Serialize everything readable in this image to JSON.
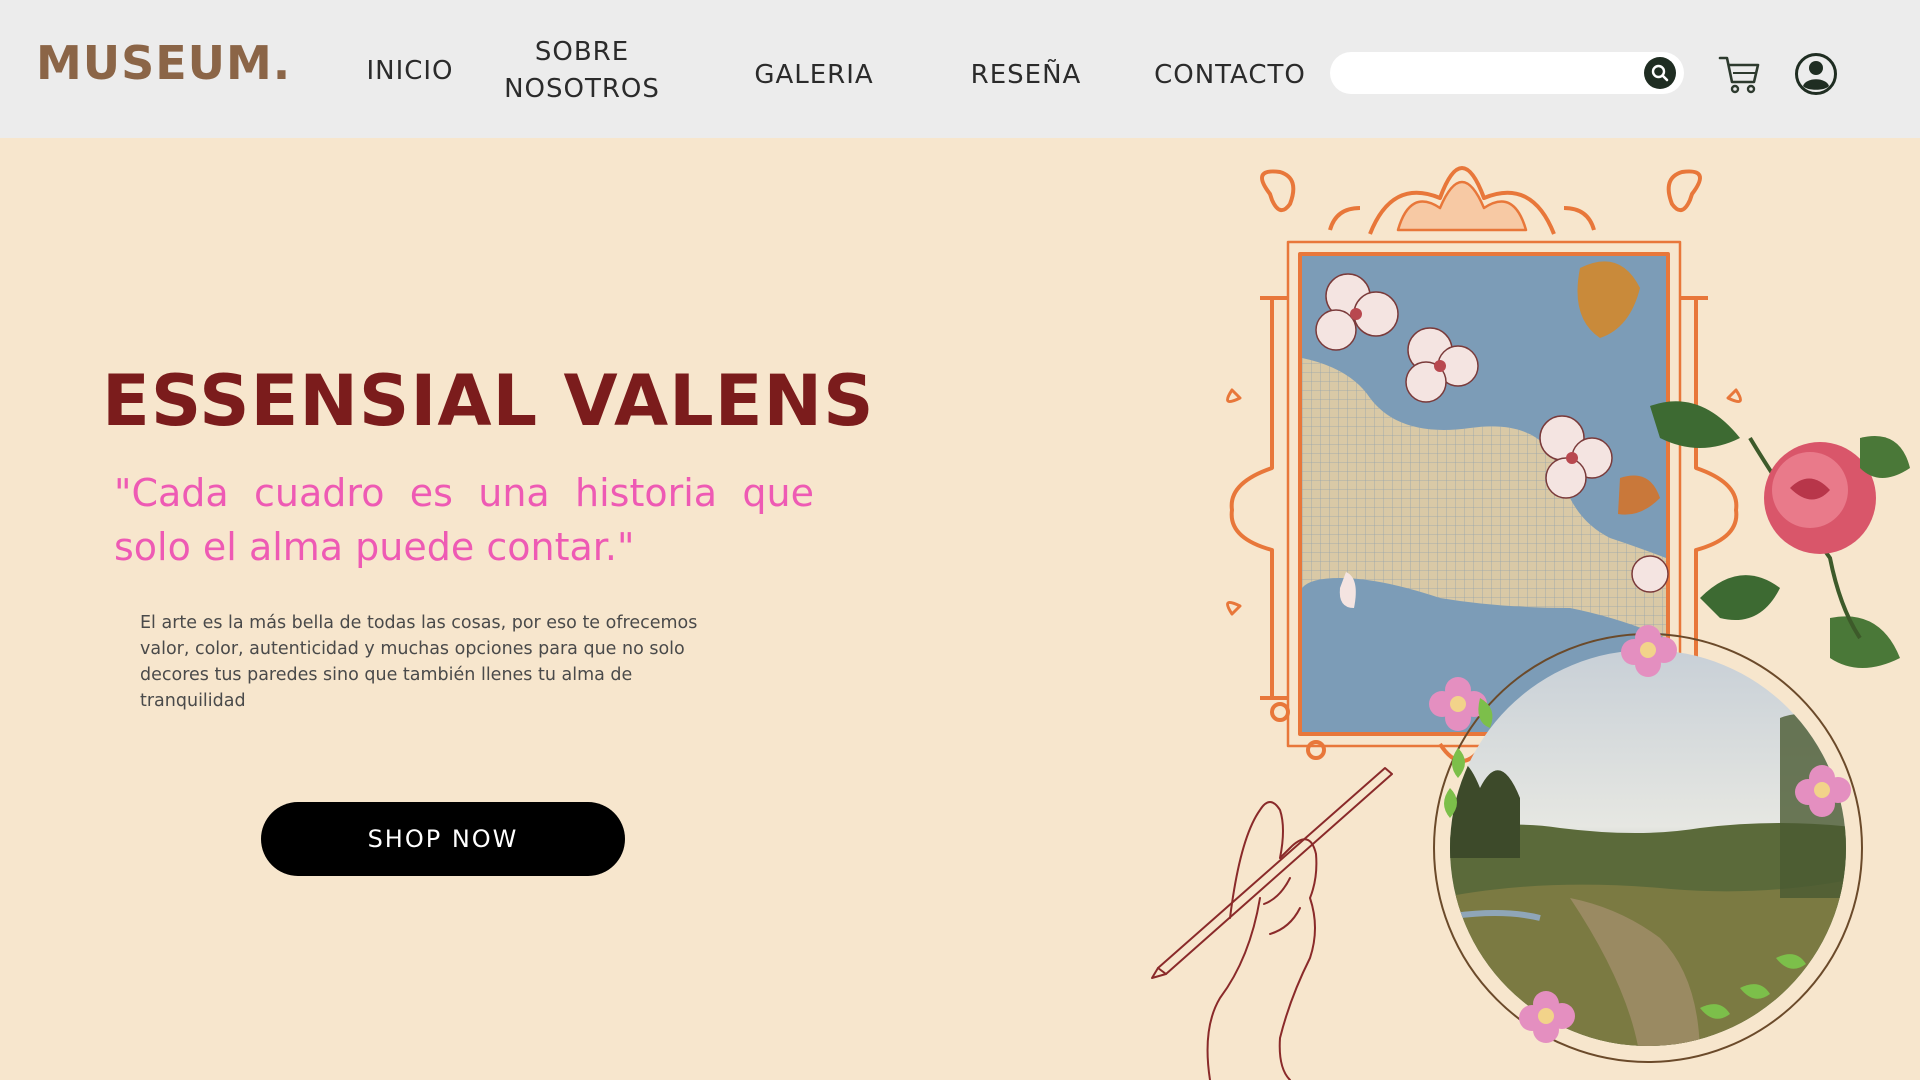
{
  "brand": {
    "logo": "MUSEUM."
  },
  "nav": {
    "items": [
      {
        "label": "INICIO"
      },
      {
        "label": "SOBRE\nNOSOTROS"
      },
      {
        "label": "GALERIA"
      },
      {
        "label": "RESEÑA"
      },
      {
        "label": "CONTACTO"
      }
    ]
  },
  "search": {
    "value": "",
    "placeholder": ""
  },
  "icons": {
    "search": "search-icon",
    "cart": "cart-icon",
    "user": "user-icon"
  },
  "hero": {
    "title": "ESSENSIAL VALENS",
    "quote": "\"Cada cuadro es una historia que solo el alma puede contar.\"",
    "description": "El arte es la más bella de todas las cosas, por eso te ofrecemos valor, color, autenticidad y muchas opciones para que no solo decores tus paredes sino que también llenes tu alma de tranquilidad",
    "cta_label": "SHOP NOW"
  },
  "colors": {
    "background": "#f7e6cd",
    "nav_bg": "#ececec",
    "logo": "#8b6547",
    "title": "#7b1c1c",
    "quote": "#ee5ab4",
    "cta_bg": "#000000",
    "frame": "#e8773a"
  }
}
